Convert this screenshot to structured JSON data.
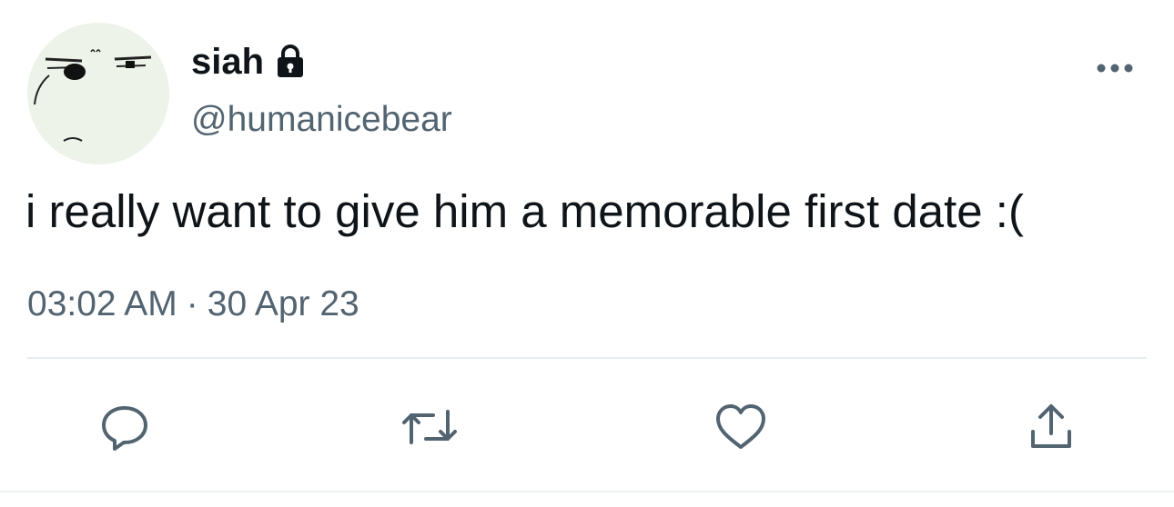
{
  "tweet": {
    "display_name": "siah",
    "handle": "@humanicebear",
    "text": "i really want to give him a memorable first date :(",
    "time": "03:02 AM",
    "separator": "·",
    "date": "30 Apr 23"
  },
  "icons": {
    "avatar": "avatar-image",
    "lock": "lock-icon",
    "more": "more-icon",
    "reply": "reply-icon",
    "retweet": "retweet-icon",
    "like": "heart-icon",
    "share": "share-icon"
  },
  "colors": {
    "text_primary": "#0f1419",
    "text_secondary": "#536471",
    "divider": "#e6ecf0"
  }
}
